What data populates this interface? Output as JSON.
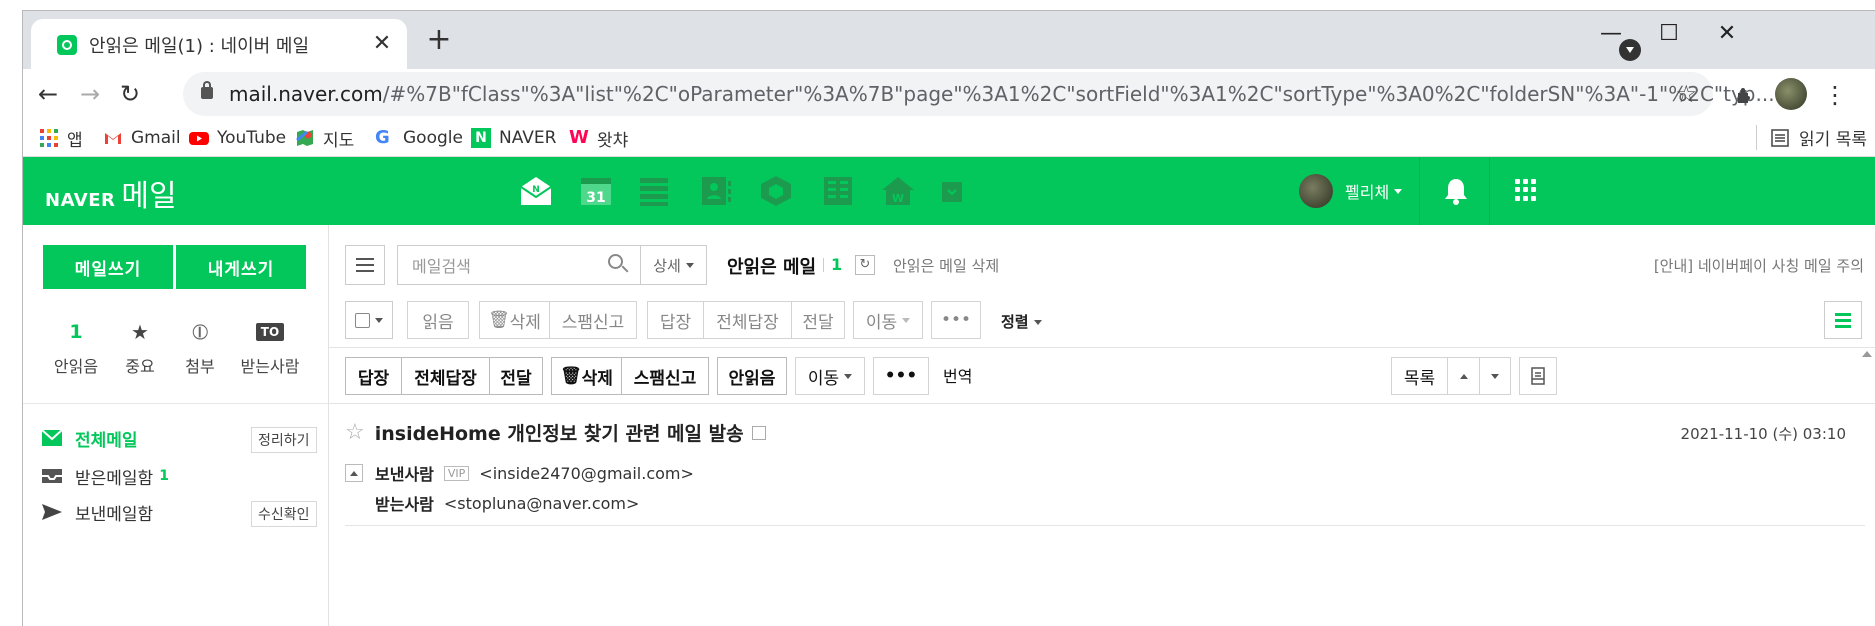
{
  "browser": {
    "tab_title": "안읽은 메일(1) : 네이버 메일",
    "url_host": "mail.naver.com",
    "url_rest": "/#%7B\"fClass\"%3A\"list\"%2C\"oParameter\"%3A%7B\"page\"%3A1%2C\"sortField\"%3A1%2C\"sortType\"%3A0%2C\"folderSN\"%3A\"-1\"%2C\"typ..."
  },
  "bookmarks": [
    {
      "label": "앱",
      "icon": "apps-grid-icon"
    },
    {
      "label": "Gmail",
      "icon": "gmail-icon"
    },
    {
      "label": "YouTube",
      "icon": "youtube-icon"
    },
    {
      "label": "지도",
      "icon": "maps-icon"
    },
    {
      "label": "Google",
      "icon": "google-icon"
    },
    {
      "label": "NAVER",
      "icon": "naver-icon"
    },
    {
      "label": "왓챠",
      "icon": "watcha-icon"
    }
  ],
  "reading_list": "읽기 목록",
  "header": {
    "brand": "NAVER",
    "service": "메일",
    "username": "펠리체",
    "accent": "#03c75a"
  },
  "sidebar": {
    "write": "메일쓰기",
    "write_self": "내게쓰기",
    "quick": [
      {
        "value": "1",
        "label": "안읽음"
      },
      {
        "value": "★",
        "label": "중요"
      },
      {
        "value": "⦶",
        "label": "첨부"
      },
      {
        "value": "TO",
        "label": "받는사람"
      }
    ],
    "folders": [
      {
        "label": "전체메일",
        "action": "정리하기"
      },
      {
        "label": "받은메일함",
        "count": "1"
      },
      {
        "label": "보낸메일함",
        "action": "수신확인"
      }
    ]
  },
  "toolbar": {
    "search_placeholder": "메일검색",
    "detail": "상세",
    "list_title": "안읽은 메일",
    "list_count": "1",
    "delete_unread": "안읽은 메일 삭제",
    "notice": "[안내] 네이버페이 사칭 메일 주의",
    "read": "읽음",
    "delete": "삭제",
    "spam": "스팸신고",
    "reply": "답장",
    "reply_all": "전체답장",
    "forward": "전달",
    "move": "이동",
    "more": "•••",
    "sort": "정렬"
  },
  "viewer": {
    "reply": "답장",
    "reply_all": "전체답장",
    "forward": "전달",
    "delete": "삭제",
    "spam": "스팸신고",
    "unread": "안읽음",
    "move": "이동",
    "more": "•••",
    "translate": "번역",
    "list": "목록",
    "subject": "insideHome 개인정보 찾기 관련 메일 발송",
    "date": "2021-11-10 (수) 03:10",
    "sender_label": "보낸사람",
    "vip": "VIP",
    "sender": "<inside2470@gmail.com>",
    "receiver_label": "받는사람",
    "receiver": "<stopluna@naver.com>"
  }
}
